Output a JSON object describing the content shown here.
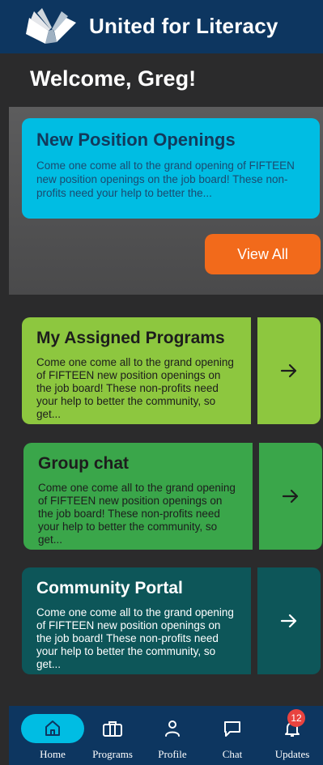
{
  "header": {
    "title": "United for Literacy"
  },
  "welcome": "Welcome, Greg!",
  "featured": {
    "title": "New Position Openings",
    "body": "Come one come all to the grand opening of FIFTEEN new position openings on the job board! These non-profits need your help to better the...",
    "button": "View All"
  },
  "cards": [
    {
      "title": "My Assigned Programs",
      "body": "Come one come all to the grand opening of FIFTEEN new position openings on the job board! These non-profits need your help to better the community, so get...",
      "arrow": "→"
    },
    {
      "title": "Group chat",
      "body": "Come one come all to the grand opening of FIFTEEN new position openings on the job board! These non-profits need your help to better the community, so get...",
      "arrow": "→"
    },
    {
      "title": "Community Portal",
      "body": "Come one come all to the grand opening of FIFTEEN new position openings on the job board! These non-profits need your help to better the community, so get...",
      "arrow": "→"
    }
  ],
  "nav": {
    "items": [
      {
        "label": "Home",
        "icon": "home-icon",
        "active": true
      },
      {
        "label": "Programs",
        "icon": "briefcase-icon"
      },
      {
        "label": "Profile",
        "icon": "user-icon"
      },
      {
        "label": "Chat",
        "icon": "chat-bubble-icon"
      },
      {
        "label": "Updates",
        "icon": "bell-icon",
        "badge": "12"
      }
    ]
  },
  "colors": {
    "navy": "#0d3660",
    "cyan": "#00bde3",
    "orange": "#f26a1b",
    "lime": "#8dc73f",
    "green": "#3aa64a",
    "teal": "#0d5659",
    "badge": "#e8433f"
  }
}
